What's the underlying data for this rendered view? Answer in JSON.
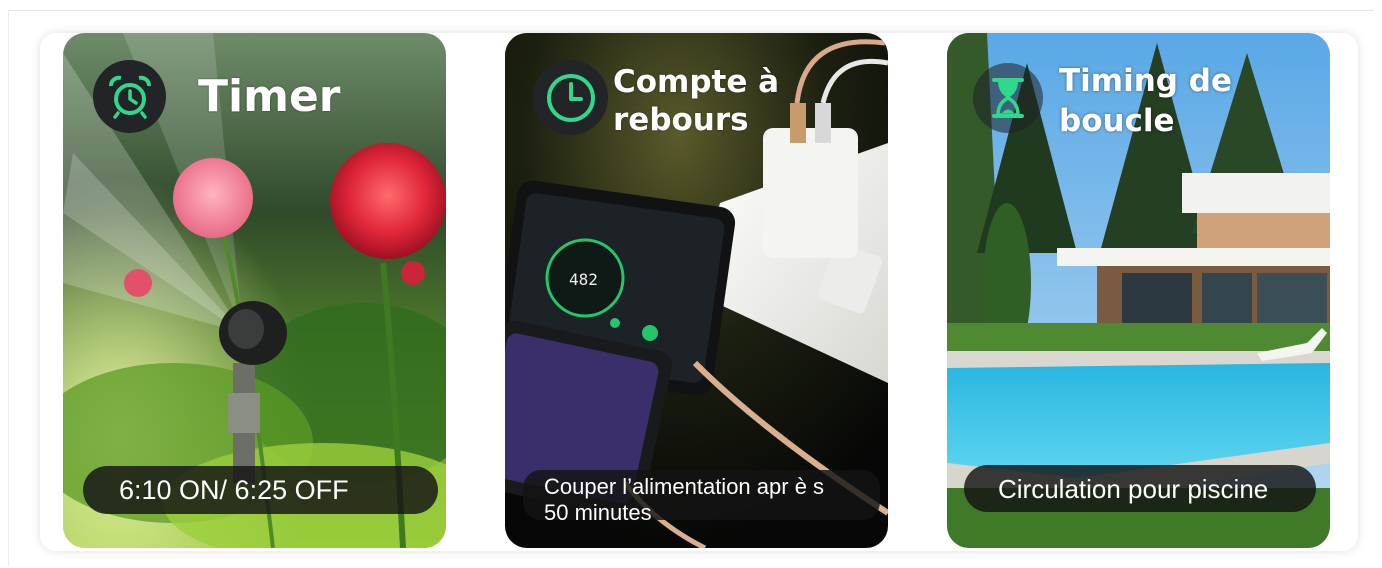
{
  "cards": [
    {
      "title": "Timer",
      "caption_lines": [
        "6:10 ON/ 6:25 OFF"
      ],
      "icon": "alarm-clock-icon"
    },
    {
      "title_lines": [
        "Compte à",
        "rebours"
      ],
      "caption_lines": [
        "Couper l’alimentation apr è s",
        "50 minutes"
      ],
      "phone_reading": "482",
      "icon": "countdown-clock-icon"
    },
    {
      "title_lines": [
        "Timing de",
        "boucle"
      ],
      "caption_lines": [
        "Circulation pour piscine"
      ],
      "icon": "hourglass-icon"
    }
  ],
  "colors": {
    "accent": "#2fd88a",
    "badge": "#222428",
    "caption_bg": "#141414"
  }
}
